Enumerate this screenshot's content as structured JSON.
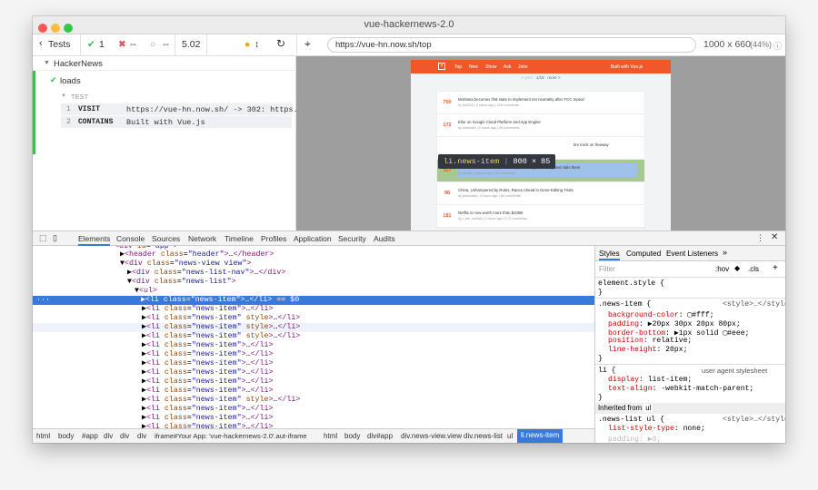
{
  "window": {
    "title": "vue-hackernews-2.0"
  },
  "toolbar": {
    "back_label": "Tests",
    "passed": "1",
    "failed": "--",
    "pending": "--",
    "duration": "5.02",
    "url": "https://vue-hn.now.sh/top",
    "viewport": "1000 x 660",
    "zoom": "(44%)"
  },
  "reporter": {
    "suite": "HackerNews",
    "test": "loads",
    "section": "TEST",
    "commands": [
      {
        "num": "1",
        "name": "VISIT",
        "msg": "https://vue-hn.now.sh/ -> 302: https.."
      },
      {
        "num": "2",
        "name": "CONTAINS",
        "msg": "Built with Vue.js"
      }
    ]
  },
  "app": {
    "nav": [
      "Top",
      "New",
      "Show",
      "Ask",
      "Jobs"
    ],
    "built": "Built with Vue.js",
    "pager": {
      "prev": "< prev",
      "page": "1/19",
      "next": "more >"
    },
    "items": [
      {
        "score": "750",
        "title": "Montana becomes first state to implement net neutrality after FCC repeal",
        "by": "by ac5215 | 5 hours ago | 108 comments"
      },
      {
        "score": "172",
        "title": "Ellor on Google Cloud Platform and App Engine",
        "by": "by shabadiz | 5 hours ago | 58 comments"
      },
      {
        "score": "",
        "title": "tire truck on freeway",
        "by": ""
      },
      {
        "score": "117",
        "title": "Since tablets are not safe to drive, our transportation system fails them",
        "by": "by ralpha | 4 hours ago | 96 comments"
      },
      {
        "score": "96",
        "title": "China, Unhampered by Rules, Races Ahead in Gene-Editing Trials",
        "by": "by paulsutter | 5 hours ago | 86 comments"
      },
      {
        "score": "181",
        "title": "Netflix is now worth more than $100B",
        "by": "by i_am_nomad | 3 hours ago | 175 comments"
      }
    ]
  },
  "tooltip": {
    "selector": "li.news-item",
    "size": "800 × 85"
  },
  "devtools": {
    "tabs": [
      "Elements",
      "Console",
      "Sources",
      "Network",
      "Timeline",
      "Profiles",
      "Application",
      "Security",
      "Audits"
    ],
    "style_tabs": [
      "Styles",
      "Computed",
      "Event Listeners"
    ],
    "filter": "Filter",
    "hov": ":hov",
    "cls": ".cls",
    "breadcrumbs": [
      "html",
      "body",
      "#app",
      "div",
      "div",
      "div",
      "iframe#Your App: 'vue-hackernews-2.0'.aut-iframe",
      "html",
      "body",
      "div#app",
      "div.news-view.view",
      "div.news-list",
      "ul",
      "li.news-item"
    ]
  },
  "colors": {
    "accent": "#3879d9",
    "hn_orange": "#f0572b",
    "pass": "#3fb950",
    "fail": "#e05252",
    "highlight": "#9fc0e8"
  }
}
